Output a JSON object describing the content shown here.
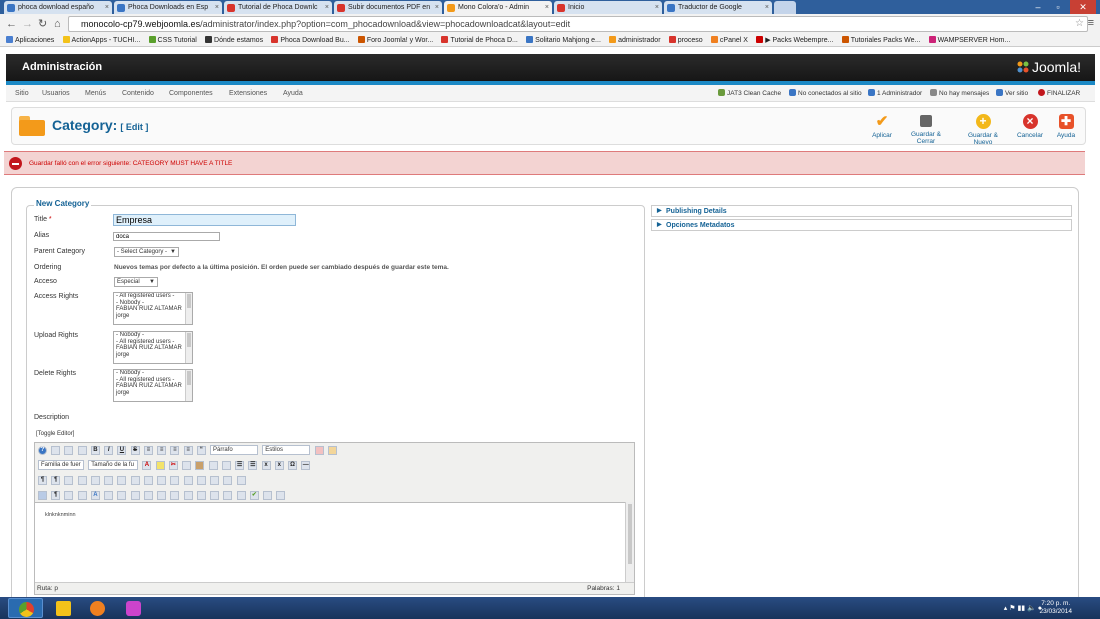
{
  "browser": {
    "tabs": [
      {
        "label": "phoca download españo",
        "color": "#3a75c4"
      },
      {
        "label": "Phoca Downloads en Esp",
        "color": "#3a75c4"
      },
      {
        "label": "Tutorial de Phoca Downlc",
        "color": "#d8342c"
      },
      {
        "label": "Subir documentos PDF en",
        "color": "#d8342c"
      },
      {
        "label": "Mono Colora'o - Admin",
        "color": "#f39a1a"
      },
      {
        "label": "Inicio",
        "color": "#d8342c"
      },
      {
        "label": "Traductor de Google",
        "color": "#3a75c4"
      }
    ],
    "url_domain": "monocolo-cp79.webjoomla.es",
    "url_path": "/administrator/index.php?option=com_phocadownload&view=phocadownloadcat&layout=edit",
    "bookmarks": [
      {
        "label": "Aplicaciones",
        "color": "#4a7fd0"
      },
      {
        "label": "ActionApps - TUCHI...",
        "color": "#f3c21a"
      },
      {
        "label": "CSS Tutorial",
        "color": "#5aa02c"
      },
      {
        "label": "Dónde estamos",
        "color": "#333333"
      },
      {
        "label": "Phoca Download Bu...",
        "color": "#d8342c"
      },
      {
        "label": "Foro Joomla! y Wor...",
        "color": "#cc5500"
      },
      {
        "label": "Tutorial de Phoca D...",
        "color": "#d8342c"
      },
      {
        "label": "Solitario Mahjong e...",
        "color": "#3a75c4"
      },
      {
        "label": "administrador",
        "color": "#f39a1a"
      },
      {
        "label": "proceso",
        "color": "#d8342c"
      },
      {
        "label": "cPanel X",
        "color": "#f08020"
      },
      {
        "label": "▶ Packs Webempre...",
        "color": "#cc0000"
      },
      {
        "label": "Tutoriales Packs We...",
        "color": "#cc5500"
      },
      {
        "label": "WAMPSERVER Hom...",
        "color": "#cc2277"
      }
    ]
  },
  "joomla": {
    "header_title": "Administración",
    "logo_text": "Joomla!",
    "menu": [
      "Sitio",
      "Usuarios",
      "Menús",
      "Contenido",
      "Componentes",
      "Extensiones",
      "Ayuda"
    ],
    "status": [
      {
        "label": "JAT3 Clean Cache",
        "color": "#6a9a3c"
      },
      {
        "label": "No conectados al sitio",
        "color": "#3a75c4"
      },
      {
        "label": "1 Administrador",
        "color": "#3a75c4"
      },
      {
        "label": "No hay mensajes",
        "color": "#888888"
      },
      {
        "label": "Ver sitio",
        "color": "#3a75c4"
      },
      {
        "label": "FINALIZAR",
        "color": "#c2161c"
      }
    ]
  },
  "toolbar": {
    "title": "Category:",
    "subtitle": "[ Edit ]",
    "buttons": [
      {
        "label": "Aplicar",
        "icon": "check-icon",
        "color": "#f39a1a"
      },
      {
        "label": "Guardar & Cerrar",
        "icon": "save-icon",
        "color": "#666666"
      },
      {
        "label": "Guardar & Nuevo",
        "icon": "plus-icon",
        "color": "#f3b81a"
      },
      {
        "label": "Cancelar",
        "icon": "cancel-icon",
        "color": "#d8342c"
      },
      {
        "label": "Ayuda",
        "icon": "help-icon",
        "color": "#e8522a"
      }
    ]
  },
  "error": "Guardar falló con el error siguiente: CATEGORY MUST HAVE A TITLE",
  "form": {
    "legend": "New Category",
    "title_label": "Title",
    "required_mark": "*",
    "title_value": "Empresa",
    "alias_label": "Alias",
    "alias_value": "doca",
    "parent_label": "Parent Category",
    "parent_value": "- Select Category -",
    "ordering_label": "Ordering",
    "ordering_text": "Nuevos temas por defecto a la última posición. El orden puede ser cambiado después de guardar este tema.",
    "acceso_label": "Acceso",
    "acceso_value": "Especial",
    "access_label": "Access Rights",
    "access_options": [
      "- All registered users -",
      "- Nobody -",
      "FABIAN RUIZ ALTAMAR",
      "jorge"
    ],
    "upload_label": "Upload Rights",
    "upload_options": [
      "- Nobody -",
      "- All registered users -",
      "FABIAN RUIZ ALTAMAR",
      "jorge"
    ],
    "delete_label": "Delete Rights",
    "delete_options": [
      "- Nobody -",
      "- All registered users -",
      "FABIAN RUIZ ALTAMAR",
      "jorge"
    ],
    "description_label": "Description",
    "toggle_editor": "[Toggle Editor]"
  },
  "editor": {
    "format_value": "Párrafo",
    "styles_value": "Estilos",
    "font_family_value": "Familia de fuer",
    "font_size_value": "Tamaño de la fu",
    "content": "klnknknminn",
    "path": "Ruta: p",
    "word_count": "Palabras: 1"
  },
  "sidebar": {
    "panes": [
      "Publishing Details",
      "Opciones Metadatos"
    ]
  },
  "taskbar": {
    "time": "7:20 p. m.",
    "date": "23/03/2014",
    "apps": [
      {
        "name": "chrome",
        "color": "#e0402c"
      },
      {
        "name": "explorer",
        "color": "#f3c21a"
      },
      {
        "name": "firefox",
        "color": "#f08020"
      },
      {
        "name": "app",
        "color": "#cc44cc"
      }
    ]
  }
}
